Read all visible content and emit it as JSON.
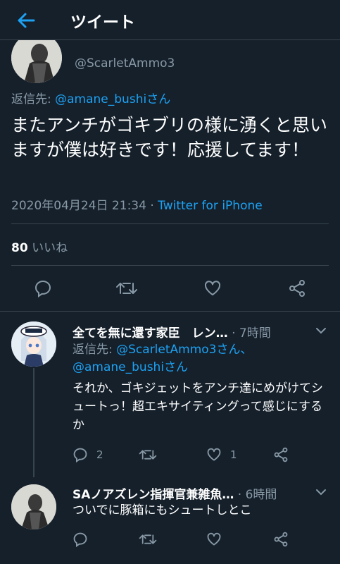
{
  "header": {
    "title": "ツイート"
  },
  "tweet": {
    "handle": "@ScarletAmmo3",
    "reply_label": "返信先: ",
    "reply_to": "@amane_bushiさん",
    "text": "またアンチがゴキブリの様に湧くと思いますが僕は好きです！応援してます！",
    "timestamp": "2020年04月24日 21:34",
    "dot": " · ",
    "source": "Twitter for iPhone",
    "likes_count": "80",
    "likes_label": " いいね"
  },
  "replies": [
    {
      "name": "全てを無に還す家臣　レン…",
      "time": " · 7時間",
      "reply_label": "返信先: ",
      "reply_to_1": "@ScarletAmmo3さん、",
      "reply_to_2": "@amane_bushiさん",
      "text": "それか、ゴキジェットをアンチ達にめがけてシュートっ！超エキサイティングって感じにするか",
      "reply_count": "2",
      "like_count": "1"
    },
    {
      "name": "SAノアズレン指揮官兼雑魚…",
      "time": " · 6時間",
      "text": "ついでに豚箱にもシュートしとこ"
    }
  ],
  "colors": {
    "background": "#15202b",
    "accent": "#1da1f2",
    "secondary_text": "#8899a6",
    "border": "#38444d"
  },
  "icons": [
    "back-arrow-icon",
    "reply-icon",
    "retweet-icon",
    "like-icon",
    "share-icon",
    "chevron-down-icon"
  ]
}
